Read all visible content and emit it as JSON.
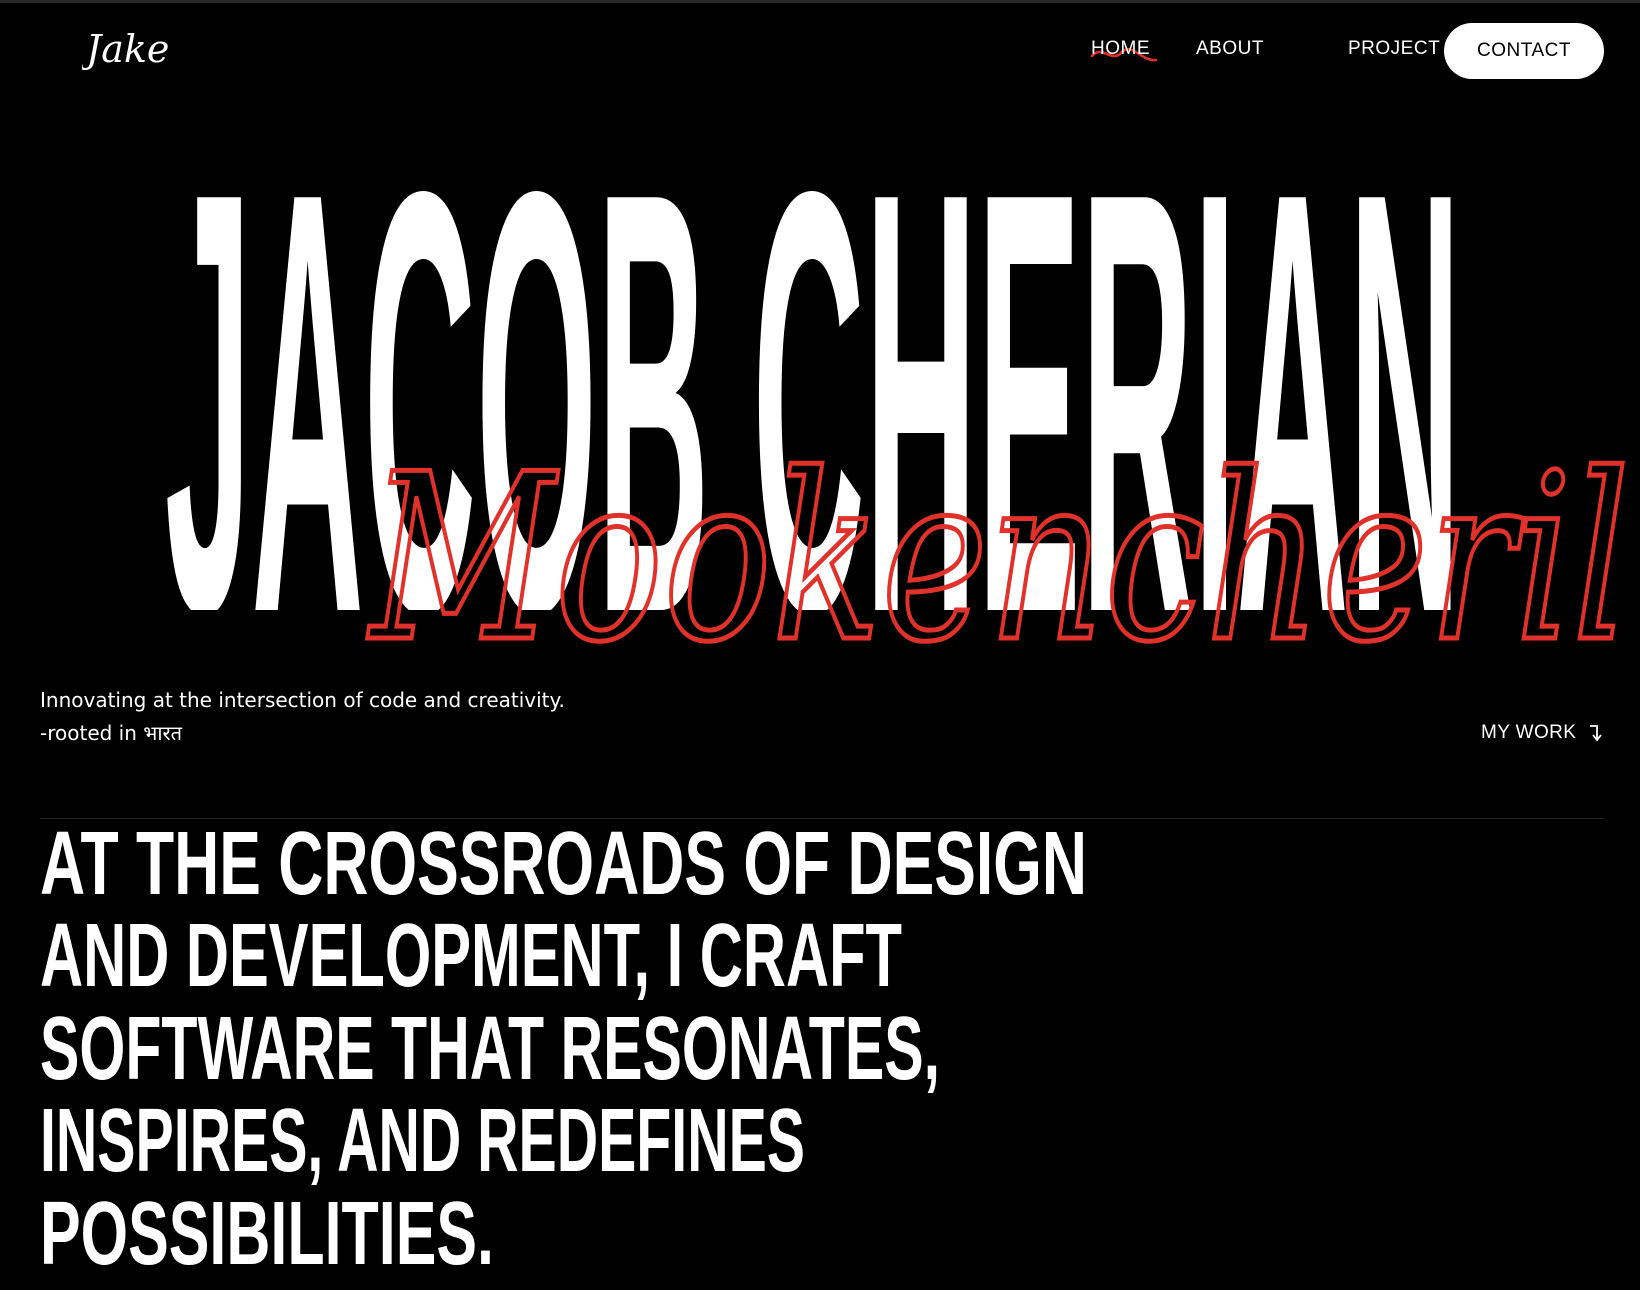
{
  "header": {
    "logo_text": "Jake.",
    "nav": {
      "home": "HOME",
      "about": "ABOUT",
      "project": "PROJECT"
    },
    "contact_label": "CONTACT"
  },
  "hero": {
    "name_main": "JACOB CHERIAN",
    "name_script": "Mookencheril",
    "tagline_line1": "Innovating at the intersection of code and creativity.",
    "tagline_line2": "-rooted in भारत",
    "mywork_label": "MY WORK"
  },
  "statement": {
    "lines": [
      "AT THE CROSSROADS OF DESIGN",
      "AND DEVELOPMENT, I CRAFT",
      "SOFTWARE THAT RESONATES,",
      "INSPIRES, AND REDEFINES",
      "POSSIBILITIES."
    ]
  },
  "colors": {
    "background": "#000000",
    "text": "#ffffff",
    "accent": "#e0322a"
  },
  "icons": {
    "mywork": "arrow-down-turn-icon",
    "home_marker": "scribble-underline-icon"
  }
}
